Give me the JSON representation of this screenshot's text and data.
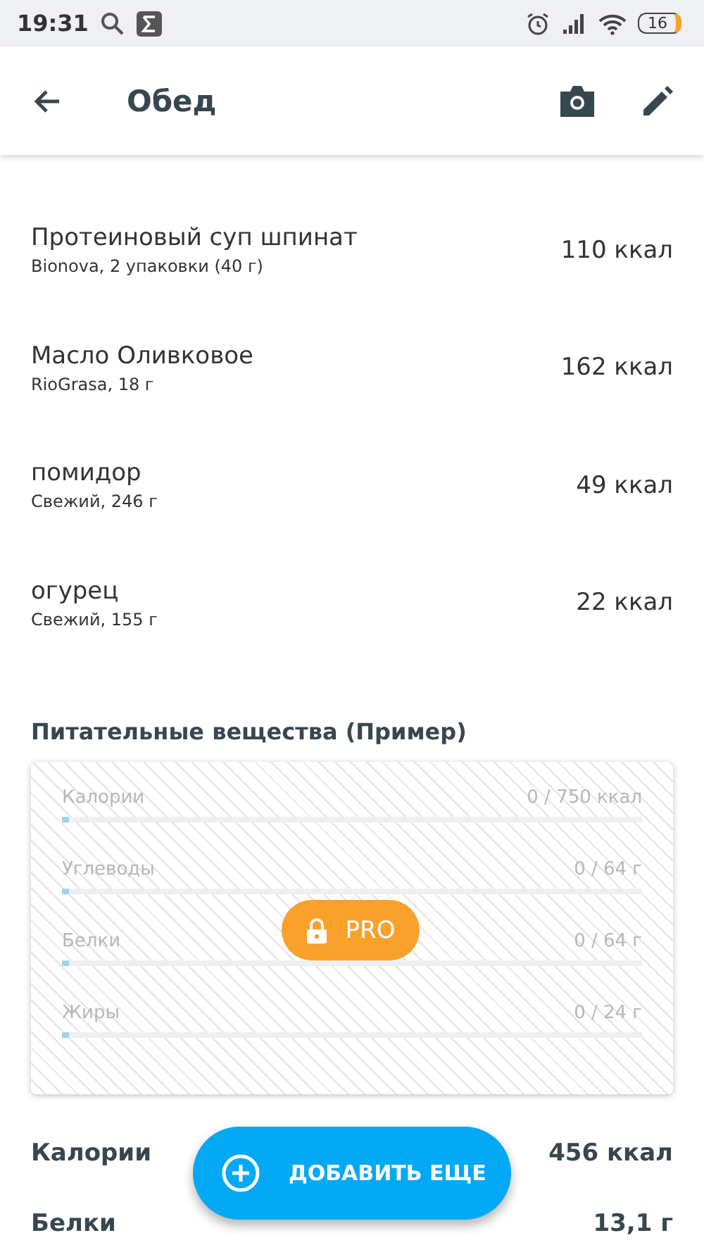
{
  "status_bar": {
    "time": "19:31",
    "battery": "16"
  },
  "app_bar": {
    "title": "Обед"
  },
  "foods": [
    {
      "name": "Протеиновый суп шпинат",
      "detail": "Bionova, 2 упаковки (40 г)",
      "calories": "110 ккал"
    },
    {
      "name": "Масло Оливковое",
      "detail": "RioGrasa, 18 г",
      "calories": "162 ккал"
    },
    {
      "name": "помидор",
      "detail": "Свежий, 246 г",
      "calories": "49 ккал"
    },
    {
      "name": "огурец",
      "detail": "Свежий, 155 г",
      "calories": "22 ккал"
    }
  ],
  "nutrients": {
    "title": "Питательные вещества (Пример)",
    "locked_label": "PRO",
    "rows": [
      {
        "name": "Калории",
        "value": "0 / 750 ккал",
        "level": 0.012
      },
      {
        "name": "Углеводы",
        "value": "0 / 64 г",
        "level": 0.012
      },
      {
        "name": "Белки",
        "value": "0 / 64 г",
        "level": 0.012
      },
      {
        "name": "Жиры",
        "value": "0 / 24 г",
        "level": 0.012
      }
    ]
  },
  "totals": [
    {
      "name": "Калории",
      "value": "456 ккал"
    },
    {
      "name": "Белки",
      "value": "13,1 г"
    }
  ],
  "fab": {
    "label": "ДОБАВИТЬ ЕЩЕ"
  }
}
